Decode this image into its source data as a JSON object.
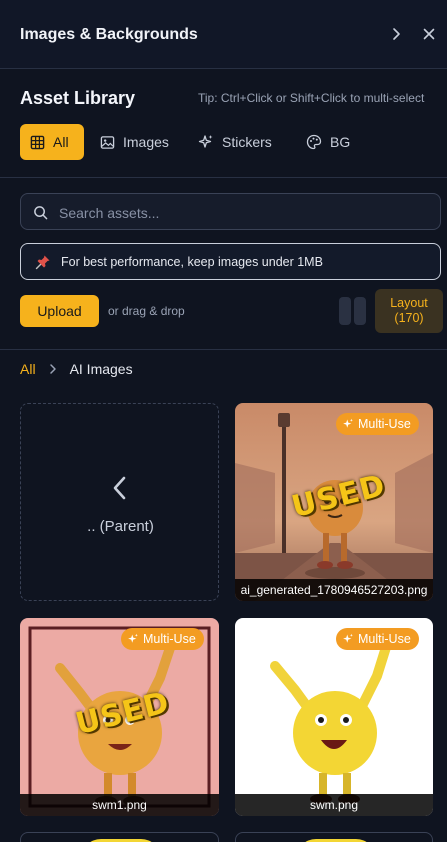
{
  "header": {
    "title": "Images & Backgrounds"
  },
  "library": {
    "title": "Asset Library",
    "tip": "Tip: Ctrl+Click or Shift+Click to multi-select",
    "tabs": [
      {
        "label": "All",
        "icon": "grid-icon",
        "active": true
      },
      {
        "label": "Images",
        "icon": "image-icon",
        "active": false
      },
      {
        "label": "Stickers",
        "icon": "sparkles-icon",
        "active": false
      },
      {
        "label": "BG",
        "icon": "palette-icon",
        "active": false
      }
    ]
  },
  "search": {
    "placeholder": "Search assets...",
    "value": ""
  },
  "notice": {
    "text": "For best performance, keep images under 1MB",
    "icon": "pushpin-icon"
  },
  "actions": {
    "upload_label": "Upload",
    "drag_text": "or drag & drop",
    "layout_label": "Layout",
    "layout_count": "(170)"
  },
  "breadcrumb": {
    "root": "All",
    "current": "AI Images"
  },
  "grid": {
    "parent_label": ".. (Parent)",
    "items": [
      {
        "filename": "ai_generated_1780946527203.png",
        "badge": "Multi-Use",
        "overlay": "USED"
      },
      {
        "filename": "swm1.png",
        "badge": "Multi-Use",
        "overlay": "USED"
      },
      {
        "filename": "swm.png",
        "badge": "Multi-Use",
        "overlay": ""
      }
    ]
  },
  "colors": {
    "accent": "#f6b21c",
    "badge": "#f39c22",
    "background": "#0f1420"
  }
}
